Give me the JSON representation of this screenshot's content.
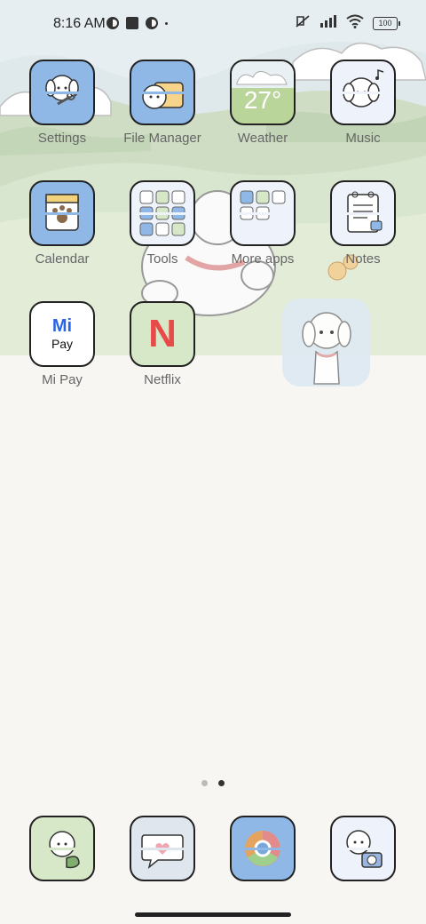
{
  "status_bar": {
    "time": "8:16 AM",
    "battery": "100",
    "left_icons": [
      "vpn-icon",
      "app-square-icon",
      "notification-icon",
      "more-dot-icon"
    ],
    "right_icons": [
      "mute-icon",
      "signal-icon",
      "wifi-icon"
    ]
  },
  "apps": [
    {
      "label": "Settings",
      "icon": "settings-dog-icon",
      "bg": "#8fb8e6"
    },
    {
      "label": "File Manager",
      "icon": "file-manager-dog-icon",
      "bg": "#8fb8e6"
    },
    {
      "label": "Weather",
      "icon": "weather-icon",
      "bg": "#b9d59a",
      "temp": "27°"
    },
    {
      "label": "Music",
      "icon": "music-dog-icon",
      "bg": "#eef3fb"
    },
    {
      "label": "Calendar",
      "icon": "calendar-icon",
      "bg": "#8fb8e6"
    },
    {
      "label": "Tools",
      "icon": "tools-folder-icon",
      "bg": "#eef3fb"
    },
    {
      "label": "More apps",
      "icon": "more-apps-folder-icon",
      "bg": "#eef3fb"
    },
    {
      "label": "Notes",
      "icon": "notes-icon",
      "bg": "#eef3fb"
    },
    {
      "label": "Mi Pay",
      "icon": "mi-pay-icon",
      "bg": "#ffffff",
      "logo_top": "Mi",
      "logo_bottom": "Pay"
    },
    {
      "label": "Netflix",
      "icon": "netflix-icon",
      "bg": "#d7e8c8",
      "logo": "N"
    }
  ],
  "dock": [
    {
      "icon": "phone-dog-icon",
      "bg": "#d7e8c8"
    },
    {
      "icon": "messages-heart-icon",
      "bg": "#dfe6ee"
    },
    {
      "icon": "chrome-icon",
      "bg": "#8fb8e6"
    },
    {
      "icon": "camera-dog-icon",
      "bg": "#eef3fb"
    }
  ],
  "pages": {
    "count": 2,
    "active": 2
  },
  "colors": {
    "text": "#666666",
    "outline": "#222222",
    "background": "#f7f6f3"
  }
}
